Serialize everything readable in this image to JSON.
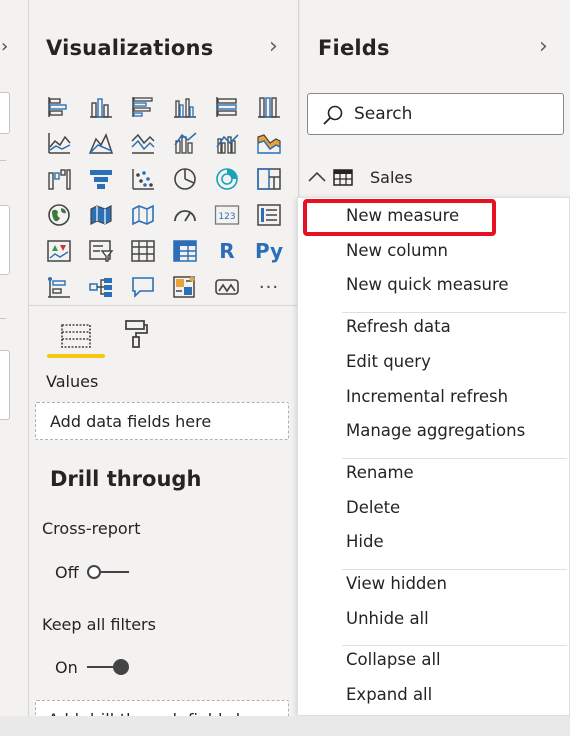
{
  "visualizations": {
    "title": "Visualizations",
    "icons": [
      "stacked-bar-chart-icon",
      "stacked-column-chart-icon",
      "clustered-bar-chart-icon",
      "clustered-column-chart-icon",
      "100-stacked-bar-chart-icon",
      "100-stacked-column-chart-icon",
      "line-chart-icon",
      "area-chart-icon",
      "stacked-area-chart-icon",
      "line-and-stacked-column-chart-icon",
      "line-and-clustered-column-chart-icon",
      "ribbon-chart-icon",
      "waterfall-chart-icon",
      "funnel-chart-icon",
      "scatter-chart-icon",
      "pie-chart-icon",
      "donut-chart-icon",
      "treemap-icon",
      "map-icon",
      "filled-map-icon",
      "shape-map-icon",
      "gauge-icon",
      "card-icon",
      "multi-row-card-icon",
      "kpi-icon",
      "slicer-icon",
      "table-icon",
      "matrix-icon",
      "r-script-visual-icon",
      "python-visual-icon",
      "key-influencers-icon",
      "decomposition-tree-icon",
      "qa-icon",
      "smart-narrative-icon",
      "paginated-report-icon",
      "more-visuals-icon"
    ],
    "r_label": "R",
    "py_label": "Py",
    "card_label": "123",
    "more_label": "···",
    "values_label": "Values",
    "values_placeholder": "Add data fields here",
    "drill_through": {
      "title": "Drill through",
      "cross_report_label": "Cross-report",
      "cross_report_state": "Off",
      "keep_filters_label": "Keep all filters",
      "keep_filters_state": "On",
      "drill_placeholder": "Add drill-through fields here"
    }
  },
  "fields": {
    "title": "Fields",
    "search_placeholder": "Search",
    "table_name": "Sales"
  },
  "context_menu": {
    "groups": [
      [
        "New measure",
        "New column",
        "New quick measure"
      ],
      [
        "Refresh data",
        "Edit query",
        "Incremental refresh",
        "Manage aggregations"
      ],
      [
        "Rename",
        "Delete",
        "Hide"
      ],
      [
        "View hidden",
        "Unhide all"
      ],
      [
        "Collapse all",
        "Expand all"
      ]
    ],
    "highlighted_item": "New measure"
  },
  "colors": {
    "accent_yellow": "#f2c811",
    "highlight_red": "#e81123",
    "icon_blue": "#2b6fb6",
    "icon_teal": "#1aa3b8",
    "icon_orange": "#e8a33d"
  }
}
